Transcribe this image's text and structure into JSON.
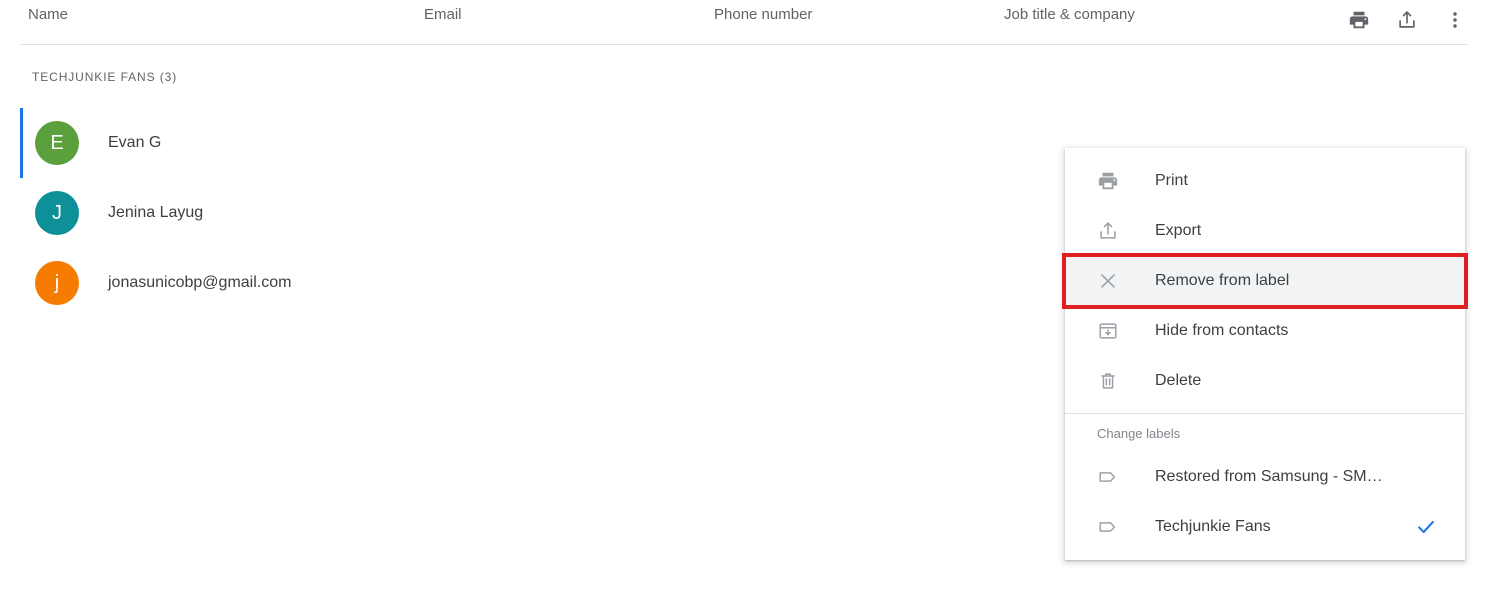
{
  "table": {
    "columns": [
      {
        "key": "name",
        "label": "Name"
      },
      {
        "key": "email",
        "label": "Email"
      },
      {
        "key": "phone",
        "label": "Phone number"
      },
      {
        "key": "job",
        "label": "Job title & company"
      }
    ],
    "actions": [
      {
        "name": "print-icon",
        "label": "Print"
      },
      {
        "name": "export-icon",
        "label": "Export"
      },
      {
        "name": "more-options-icon",
        "label": "More options"
      }
    ]
  },
  "group": {
    "title": "TECHJUNKIE FANS (3)",
    "label_name": "Techjunkie Fans",
    "count": 3
  },
  "contacts": [
    {
      "initial": "E",
      "name": "Evan G",
      "color": "#5ba03c",
      "selected": true
    },
    {
      "initial": "J",
      "name": "Jenina Layug",
      "color": "#0e9098",
      "selected": false
    },
    {
      "initial": "j",
      "name": "jonasunicobp@gmail.com",
      "color": "#f57c00",
      "selected": false
    }
  ],
  "menu": {
    "items": [
      {
        "icon": "print-icon",
        "label": "Print",
        "state": "normal"
      },
      {
        "icon": "export-icon",
        "label": "Export",
        "state": "normal"
      },
      {
        "icon": "close-icon",
        "label": "Remove from label",
        "state": "highlighted"
      },
      {
        "icon": "archive-icon",
        "label": "Hide from contacts",
        "state": "normal"
      },
      {
        "icon": "trash-icon",
        "label": "Delete",
        "state": "normal"
      }
    ],
    "section_title": "Change labels",
    "labels": [
      {
        "icon": "label-icon",
        "label": "Restored from Samsung - SM…",
        "checked": false
      },
      {
        "icon": "label-icon",
        "label": "Techjunkie Fans",
        "checked": true
      }
    ]
  },
  "colors": {
    "accent": "#1a73e8",
    "highlight_border": "#e02020",
    "hover_background": "#f1f3f4",
    "text_primary": "#3c4043",
    "text_secondary": "#5f6368",
    "icon_muted": "#9aa0a6",
    "divider": "#e0e0e0"
  }
}
